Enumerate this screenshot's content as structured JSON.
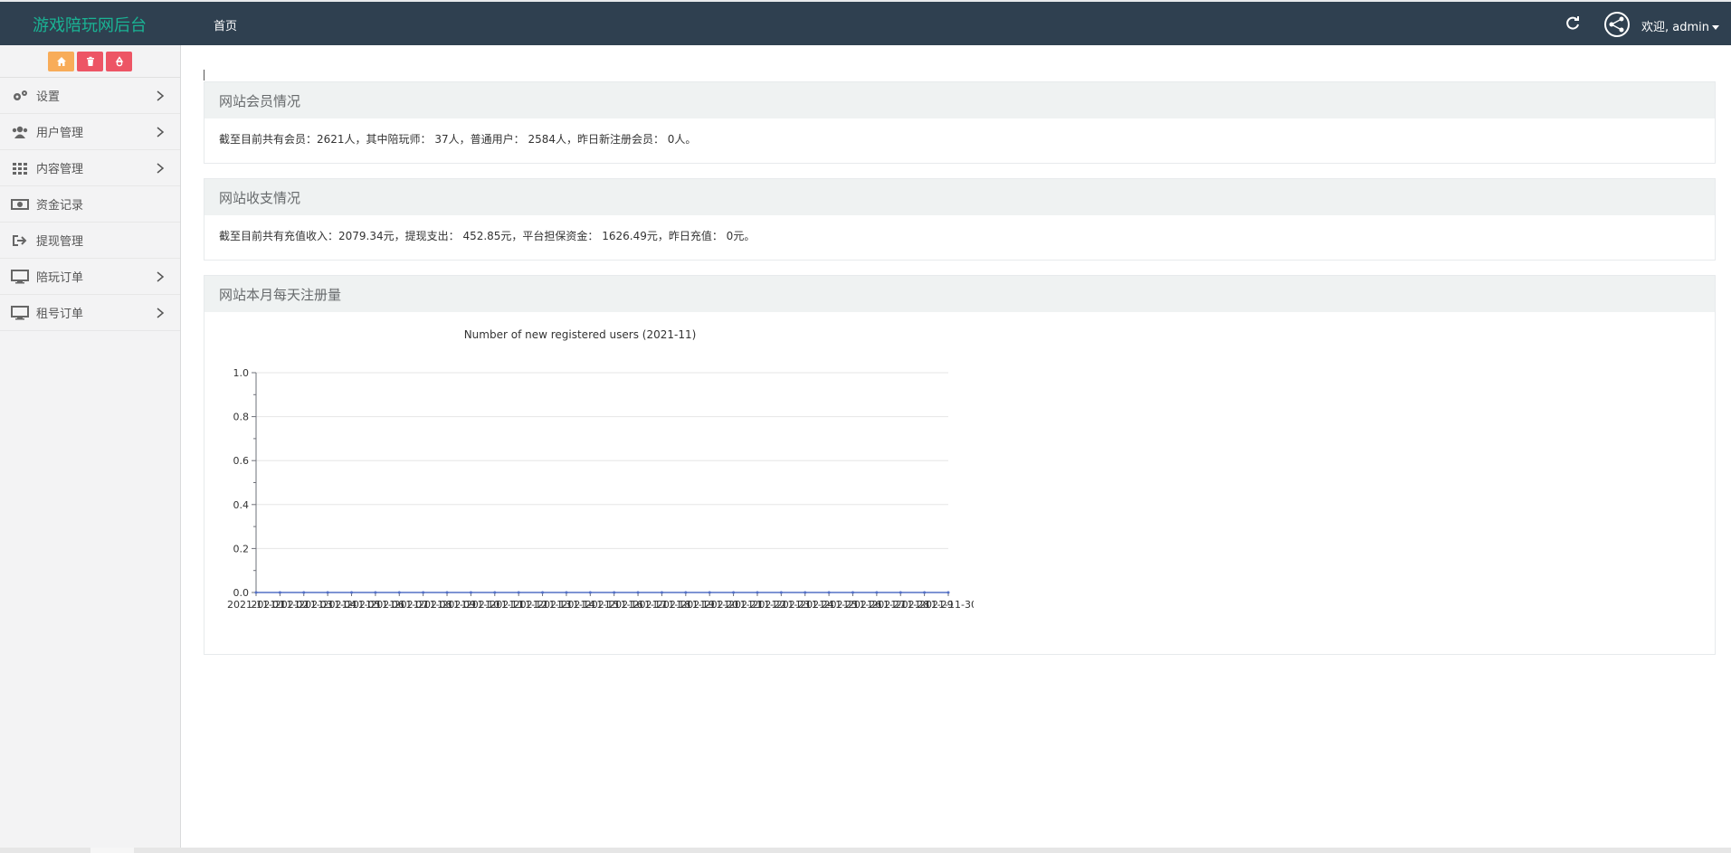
{
  "header": {
    "brand": "游戏陪玩网后台",
    "home_link": "首页",
    "welcome": "欢迎, admin",
    "icons": [
      "refresh-icon",
      "avatar-icon"
    ]
  },
  "sidebar": {
    "quick_buttons": [
      {
        "icon": "home-icon",
        "color": "#f8ac59"
      },
      {
        "icon": "trash-icon",
        "color": "#ed5565"
      },
      {
        "icon": "recycle-icon",
        "color": "#ed5565"
      }
    ],
    "items": [
      {
        "label": "设置",
        "icon": "gears-icon",
        "has_children": true
      },
      {
        "label": "用户管理",
        "icon": "users-icon",
        "has_children": true
      },
      {
        "label": "内容管理",
        "icon": "grid-icon",
        "has_children": true
      },
      {
        "label": "资金记录",
        "icon": "money-icon",
        "has_children": false
      },
      {
        "label": "提现管理",
        "icon": "sign-out-icon",
        "has_children": false
      },
      {
        "label": "陪玩订单",
        "icon": "desktop-icon",
        "has_children": true
      },
      {
        "label": "租号订单",
        "icon": "desktop-icon",
        "has_children": true
      }
    ]
  },
  "panels": {
    "members": {
      "title": "网站会员情况",
      "text": "截至目前共有会员：2621人，其中陪玩师： 37人，普通用户： 2584人，昨日新注册会员： 0人。"
    },
    "finance": {
      "title": "网站收支情况",
      "text": "截至目前共有充值收入：2079.34元，提现支出： 452.85元，平台担保资金： 1626.49元，昨日充值： 0元。"
    },
    "registrations": {
      "title": "网站本月每天注册量"
    }
  },
  "chart_data": {
    "type": "line",
    "title": "Number of new registered users (2021-11)",
    "xlabel": "",
    "ylabel": "",
    "ylim": [
      0,
      1.0
    ],
    "yticks": [
      "0.0",
      "0.2",
      "0.4",
      "0.6",
      "0.8",
      "1.0"
    ],
    "categories": [
      "2021-11-01",
      "2021-11-02",
      "2021-11-03",
      "2021-11-04",
      "2021-11-05",
      "2021-11-06",
      "2021-11-07",
      "2021-11-08",
      "2021-11-09",
      "2021-11-10",
      "2021-11-11",
      "2021-11-12",
      "2021-11-13",
      "2021-11-14",
      "2021-11-15",
      "2021-11-16",
      "2021-11-17",
      "2021-11-18",
      "2021-11-19",
      "2021-11-20",
      "2021-11-21",
      "2021-11-22",
      "2021-11-23",
      "2021-11-24",
      "2021-11-25",
      "2021-11-26",
      "2021-11-27",
      "2021-11-28",
      "2021-11-29",
      "2021-11-30"
    ],
    "values": [
      0,
      0,
      0,
      0,
      0,
      0,
      0,
      0,
      0,
      0,
      0,
      0,
      0,
      0,
      0,
      0,
      0,
      0,
      0,
      0,
      0,
      0,
      0,
      0,
      0,
      0,
      0,
      0,
      0,
      0
    ],
    "grid": true,
    "colors": {
      "grid": "#e6e6e6",
      "axis": "#6e7079",
      "text": "#333333"
    }
  }
}
